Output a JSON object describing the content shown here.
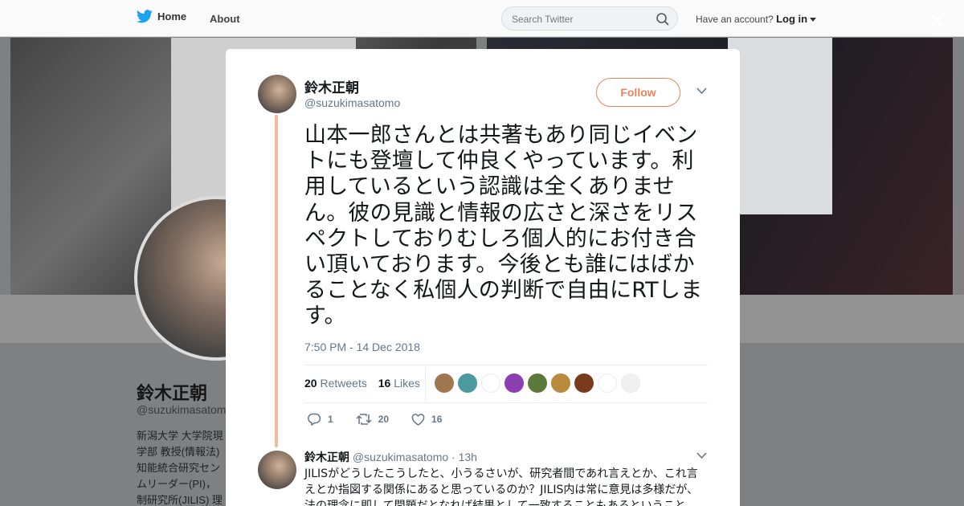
{
  "nav": {
    "home_label": "Home",
    "about_label": "About",
    "search_placeholder": "Search Twitter",
    "account_prompt": "Have an account?",
    "login_label": "Log in"
  },
  "background_profile": {
    "name": "鈴木正朝",
    "handle": "@suzukimasatomo",
    "bio_visible": "新潟大学 大学院現\n学部 教授(情報法)\n知能統合研究セン\nムリーダー(PI)，\n制研究所(JILIS) 理"
  },
  "tweet": {
    "author_name": "鈴木正朝",
    "author_handle": "@suzukimasatomo",
    "follow_label": "Follow",
    "text": "山本一郎さんとは共著もあり同じイベントにも登壇して仲良くやっています。利用しているという認識は全くありません。彼の見識と情報の広さと深さをリスペクトしておりむしろ個人的にお付き合い頂いております。今後とも誰にはばかることなく私個人の判断で自由にRTします。",
    "timestamp": "7:50 PM - 14 Dec 2018",
    "retweet_count": "20",
    "retweet_label": "Retweets",
    "like_count": "16",
    "like_label": "Likes",
    "reply_action_count": "1",
    "retweet_action_count": "20",
    "like_action_count": "16",
    "liker_avatar_colors": [
      "#a07850",
      "#4a9a9e",
      "#ffffff",
      "#8b3fb0",
      "#5b7a3c",
      "#b88a3a",
      "#7a3b1c",
      "#ffffff",
      "#f0f0f0"
    ]
  },
  "reply": {
    "author_name": "鈴木正朝",
    "author_handle": "@suzukimasatomo",
    "age": "· 13h",
    "text": "JILISがどうしたこうしたと、小うるさいが、研究者間であれ言えとか、これ言えとか指図する関係にあると思っているのか？JILIS内は常に意見は多様だが、法の理念に即して問題だとなれば結果として一致することもあるということ"
  },
  "colors": {
    "accent": "#e8845c",
    "thread_line": "#f5b99b",
    "twitter_blue": "#1da1f2"
  }
}
